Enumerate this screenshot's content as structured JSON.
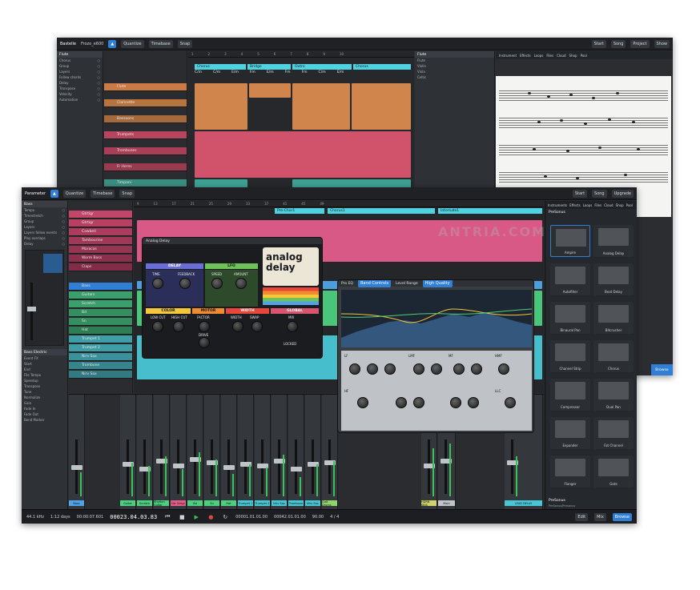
{
  "back_window": {
    "song_title": "Bastelle",
    "song_sub": "Frozo_e600",
    "toolbar": [
      "Quantize",
      "Timebase",
      "Snap",
      "Start",
      "Song",
      "Project",
      "Show"
    ],
    "markers": [
      "Chorus",
      "Bridge",
      "Outro",
      "Chorus"
    ],
    "chords": [
      "C/m",
      "C/m",
      "E/m",
      "Fm",
      "E/m",
      "Fm",
      "Fm",
      "C/m",
      "E/m"
    ],
    "tracks": [
      "Flute",
      "Clarinette",
      "Bassoons",
      "Trumpets",
      "Trombones",
      "Fr Horns",
      "Timpani",
      "Glockenspiel"
    ],
    "editor_items": [
      "Flute",
      "Violin",
      "Viola",
      "Celtic"
    ],
    "score_tabs": [
      "Instrument",
      "Effects",
      "Loops",
      "Files",
      "Cloud",
      "Shop",
      "Pool"
    ],
    "panel_rows": [
      "Chorus",
      "Group",
      "Layers",
      "Follow chords",
      "Delay",
      "Transpose",
      "Velocity",
      "Automation"
    ]
  },
  "front_window": {
    "song_title": "Parameter",
    "toolbar": [
      "Quantize",
      "Timebase",
      "Snap",
      "Start",
      "Song",
      "Upgrade"
    ],
    "markers": [
      "Pre-Chor1",
      "Chorus1",
      "Interlude1"
    ],
    "tracks": [
      "Gtrtigr",
      "Gtrtigr",
      "Cowbell",
      "Tambourine",
      "Maracas",
      "Worm Bass",
      "Claps",
      "Bass",
      "Guitars",
      "Scratch",
      "Bd",
      "Sn",
      "Hat",
      "Trumpet 1",
      "Trumpet 2",
      "Nirv Sax",
      "Trombone",
      "Nirv Sax"
    ],
    "inspector": {
      "title": "Bass",
      "rows": [
        "Tempo",
        "Timestretch",
        "Group",
        "Layers",
        "Layers follow events",
        "Play overlaps",
        "Delay"
      ],
      "event_title": "Bass Electric",
      "event_rows": [
        "Event FX",
        "Start",
        "End",
        "File Tempo",
        "Speedup",
        "Transpose",
        "Tune",
        "Normalize",
        "Gain",
        "Fade In",
        "Fade Out",
        "Bend Marker",
        "Threshold",
        "Gain Envelope",
        "Time Lock",
        "Edit Lock"
      ]
    },
    "mixer_channels": [
      "Bass",
      "Guitar",
      "Scratch",
      "Rhythm Guitar",
      "Gtr Gtrigr",
      "Bd",
      "Sn",
      "Hat",
      "Trumpet 1",
      "Trumpet 2",
      "Nirv Sax",
      "Trombone",
      "Nirv Sax",
      "Guit Drums",
      "HDRN KBIS",
      "Main",
      "LEAD DELAY"
    ],
    "browser": {
      "tabs": [
        "Instruments",
        "Effects",
        "Loops",
        "Files",
        "Cloud",
        "Shop",
        "Pool"
      ],
      "vendor": "PreSonus",
      "items": [
        "Ampire",
        "Analog Delay",
        "Autofilter",
        "Beat Delay",
        "Binaural Pan",
        "Bitcrusher",
        "Channel Strip",
        "Chorus",
        "Compressor",
        "Dual Pan",
        "Expander",
        "Fat Channel",
        "Flanger",
        "Gate"
      ],
      "footer": "PreSonus",
      "footer_sub": "PreSonus/Presonus"
    },
    "transport": {
      "sample_rate": "44.1 kHz",
      "length": "1:12 days",
      "time1": "00:00:07.601",
      "position": "00023.04.03.83",
      "loop_start": "00001.01.01.00",
      "loop_end": "00042.01.01.00",
      "tempo": "90.00",
      "signature": "4 / 4",
      "buttons": [
        "Edit",
        "Mix",
        "Browse"
      ]
    }
  },
  "analog_delay": {
    "title": "Analog Delay",
    "brand": "analog delay",
    "sections": [
      "DELAY",
      "LFO",
      "COLOR",
      "MOTOR",
      "WIDTH",
      "GLOBAL"
    ],
    "knobs": [
      "TIME",
      "FEEDBACK",
      "SPEED",
      "AMOUNT",
      "LOW CUT",
      "HIGH CUT",
      "FACTOR",
      "DRIVE",
      "WIDTH",
      "SWAP",
      "MIX",
      "LOCKED"
    ]
  },
  "pro_eq": {
    "title": "Pro EQ",
    "bands": [
      "LF",
      "LMF",
      "MF",
      "HMF",
      "HF",
      "LLC"
    ],
    "mode": "Band Controls",
    "level": "Level Range",
    "quality": "High Quality"
  },
  "watermark": "ANTRIA.COM",
  "colors": {
    "accent": "#2f7fd6",
    "bg": "#2b2d31",
    "orange": "#d98a4f",
    "pink": "#d9546f",
    "teal": "#3fa89a",
    "cyan": "#4fd3e0"
  }
}
